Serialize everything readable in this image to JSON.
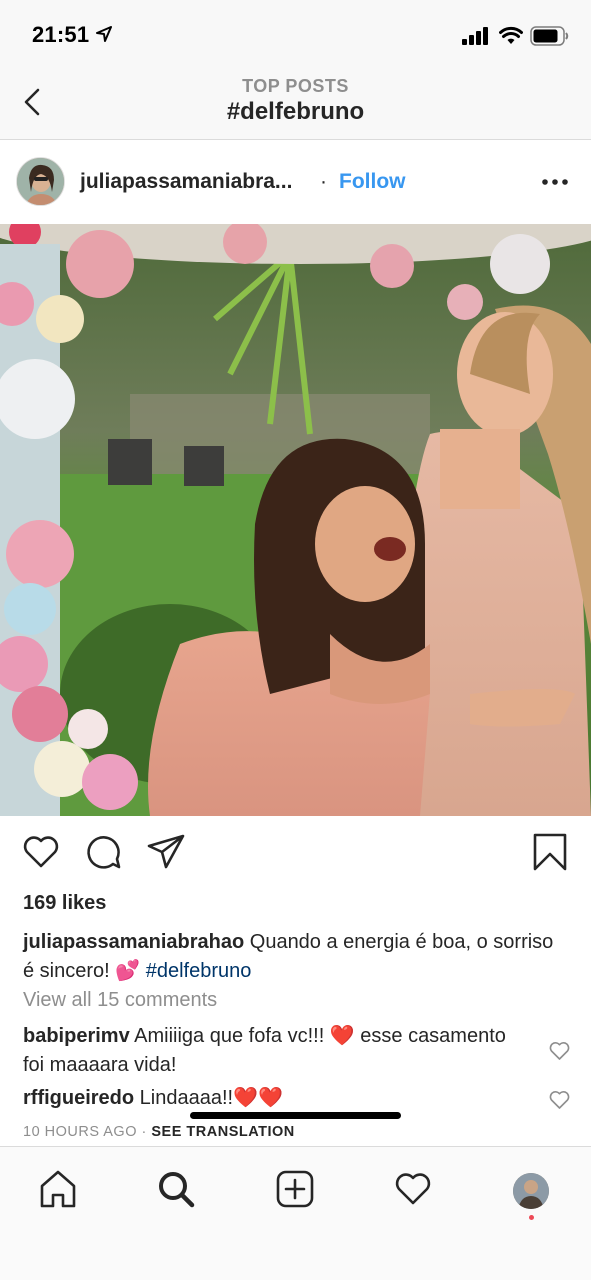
{
  "status_bar": {
    "time": "21:51",
    "icons": [
      "location-arrow-icon",
      "cellular-signal-icon",
      "wifi-icon",
      "battery-icon"
    ]
  },
  "header": {
    "subtitle": "TOP POSTS",
    "title": "#delfebruno",
    "back_icon": "chevron-left-icon"
  },
  "post": {
    "username": "juliapassamaniabra...",
    "separator": "·",
    "follow_label": "Follow",
    "more_icon": "more-horizontal-icon",
    "image_icon": "photo-two-women-floral-arch",
    "actions": [
      "heart-icon",
      "comment-icon",
      "share-icon",
      "bookmark-icon"
    ],
    "likes": "169 likes",
    "caption": {
      "username": "juliapassamaniabrahao",
      "text": " Quando a energia é boa, o sorriso é sincero! 💕 ",
      "hashtag": "#delfebruno"
    },
    "view_comments": "View all 15 comments",
    "comments": [
      {
        "username": "babiperimv",
        "text": " Amiiiiga que fofa vc!!! ❤️ esse casamento foi maaaara vida!"
      },
      {
        "username": "rffigueiredo",
        "text": " Lindaaaa!!❤️❤️"
      }
    ],
    "timestamp": "10 HOURS AGO",
    "timestamp_sep": " · ",
    "see_translation": "SEE TRANSLATION"
  },
  "tab_bar": {
    "tabs": [
      "home-icon",
      "search-icon",
      "add-post-icon",
      "activity-heart-icon",
      "profile-avatar"
    ]
  },
  "colors": {
    "accent": "#3897f0",
    "hashtag": "#003569",
    "muted": "#8e8e8e",
    "heart_red": "#ed4956",
    "text": "#262626"
  }
}
